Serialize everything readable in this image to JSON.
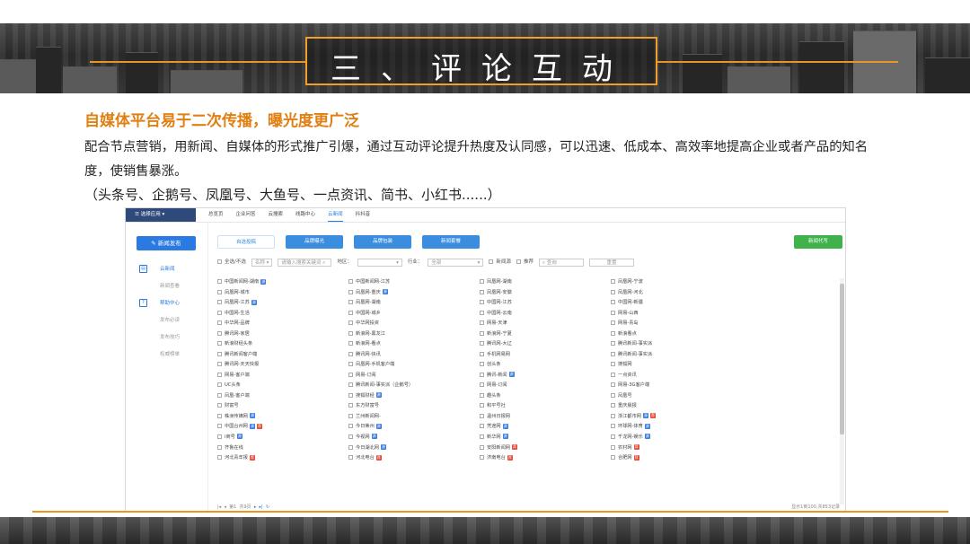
{
  "slide": {
    "title": "三、评论互动",
    "subtitle": "自媒体平台易于二次传播，曝光度更广泛",
    "paragraph": "配合节点营销，用新闻、自媒体的形式推广引爆，通过互动评论提升热度及认同感，可以迅速、低成本、高效率地提高企业或者产品的知名度，使销售暴涨。",
    "platforms": "（头条号、企鹅号、凤凰号、大鱼号、一点资讯、简书、小红书......）",
    "accent_color": "#e8961e"
  },
  "app": {
    "app_menu": "选择应用",
    "nav_tabs": [
      "总览页",
      "企业问答",
      "云搜索",
      "线路中心",
      "云新闻",
      "抖抖音"
    ],
    "active_nav": "云新闻",
    "publish_button": "新闻发布",
    "sidebar": [
      {
        "label": "云新闻",
        "type": "section",
        "icon": "news-icon"
      },
      {
        "label": "新闻查看",
        "type": "sub"
      },
      {
        "label": "帮助中心",
        "type": "section",
        "icon": "help-icon"
      },
      {
        "label": "发布必读",
        "type": "sub"
      },
      {
        "label": "发布技巧",
        "type": "sub"
      },
      {
        "label": "权威榜单",
        "type": "sub"
      }
    ],
    "filter_tabs": [
      "自选投稿",
      "品牌曝光",
      "品牌包装",
      "新闻套餐"
    ],
    "active_filter_tab": "自选投稿",
    "green_button": "新闻代写",
    "filter": {
      "select_all": "全选/不选",
      "name_select": "名称",
      "search_placeholder": "请输入搜索关键词",
      "region_label": "地区：",
      "industry_label": "行业：",
      "industry_value": "全部",
      "news_source": "新闻源",
      "recommend": "推荐",
      "query_button": "查询",
      "reset_button": "重置"
    },
    "sites": [
      [
        "中国新闻网-湖南",
        "中国新闻网-江苏",
        "凤凰网-湖南",
        "凤凰网-宁波"
      ],
      [
        "凤凰网-城市",
        "凤凰网-重庆",
        "凤凰网-安徽",
        "凤凰网-河北"
      ],
      [
        "凤凰网-江苏",
        "凤凰网-湖南",
        "中国网-江苏",
        "中国网-新疆"
      ],
      [
        "中国网-生活",
        "中国网-城乡",
        "中国网-云南",
        "网易-山西"
      ],
      [
        "中华网-品牌",
        "中华网投资",
        "网易-天津",
        "网易-青岛"
      ],
      [
        "腾讯网-家居",
        "新浪网-黑龙江",
        "新浪网-宁夏",
        "新浪看点"
      ],
      [
        "新浪财经头条",
        "新浪网-看点",
        "腾讯网-大辽",
        "腾讯新闻-事实派"
      ],
      [
        "腾讯新闻客户端",
        "腾讯网-快讯",
        "手机网易网",
        "腾讯新闻-事实派"
      ],
      [
        "腾讯网-天天快报",
        "凤凰网-手机客户端",
        "创头条",
        "搜狐网"
      ],
      [
        "网易-客户端",
        "网易-订阅",
        "腾讯-新闻",
        "一点资讯"
      ],
      [
        "UC头条",
        "腾讯新闻-事实派（企鹅号）",
        "网易-订阅",
        "网易-3G客户端"
      ],
      [
        "凤凰-客户端",
        "搜狐财经",
        "趣头条",
        "凤凰号"
      ],
      [
        "财富号",
        "东方财富号",
        "和平号社",
        "重庆晨报"
      ],
      [
        "株洲传媒网",
        "兰州新闻网-",
        "温州日报网",
        "浙江都市网"
      ],
      [
        "中国台州网",
        "今日焦州",
        "凭途网",
        "环球网-体育"
      ],
      [
        "i商号",
        "今视网",
        "新华网",
        "千龙网-娱乐"
      ],
      [
        "齐鲁在线",
        "今日湖北网",
        "安阳新闻网",
        "农村网"
      ],
      [
        "河北青年报",
        "河北电台",
        "济南电台",
        "合肥网"
      ]
    ],
    "pager": {
      "page_label": "第1",
      "total_pages": "共9页",
      "count": "显示1到100,共853记录"
    }
  }
}
